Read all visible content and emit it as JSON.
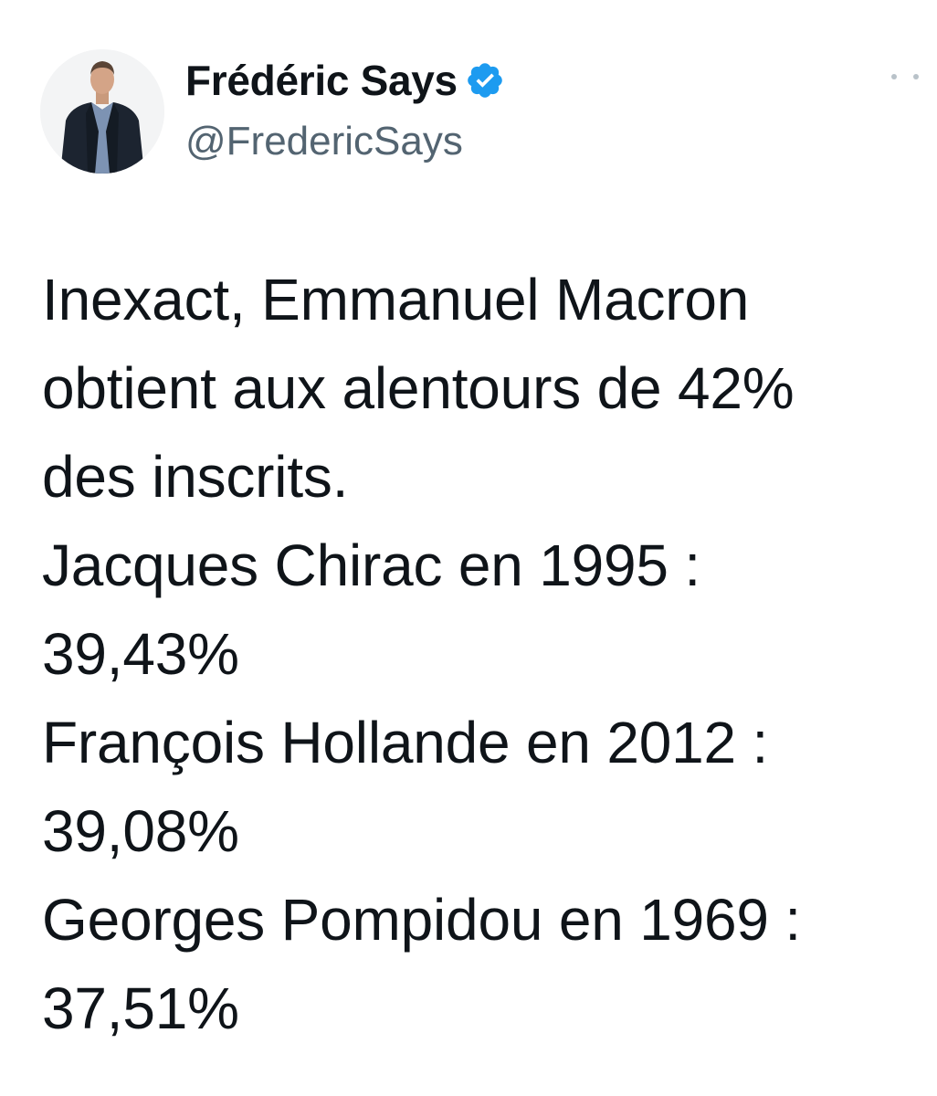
{
  "tweet": {
    "author": {
      "display_name": "Frédéric Says",
      "handle": "@FredericSays",
      "verified": true,
      "verified_color": "#1d9bf0"
    },
    "text_lines": [
      "Inexact, Emmanuel Macron",
      "obtient aux alentours de 42%",
      "des inscrits.",
      "Jacques Chirac en 1995 :",
      "39,43%",
      "François Hollande en 2012 :",
      "39,08%",
      "Georges Pompidou en 1969 :",
      "37,51%"
    ]
  },
  "colors": {
    "text": "#0f1419",
    "secondary": "#536471",
    "background": "#ffffff"
  },
  "icons": {
    "avatar": "avatar",
    "verified": "verified-badge-icon",
    "more": "more-options-icon"
  }
}
